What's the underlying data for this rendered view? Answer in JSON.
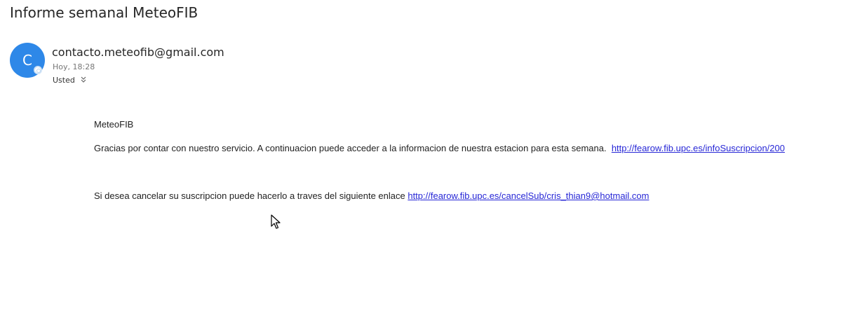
{
  "email": {
    "subject": "Informe semanal MeteoFIB",
    "avatar_letter": "C",
    "sender": "contacto.meteofib@gmail.com",
    "time": "Hoy, 18:28",
    "recipient": "Usted",
    "recipient_chevron": "»",
    "body": {
      "greeting": "MeteoFIB",
      "info_text": "Gracias por contar con nuestro servicio. A continuacion puede acceder a la informacion de nuestra estacion para esta semana.",
      "info_link": "http://fearow.fib.upc.es/infoSuscripcion/200",
      "cancel_text": "Si desea cancelar su suscripcion puede hacerlo a traves del siguiente enlace",
      "cancel_link": "http://fearow.fib.upc.es/cancelSub/cris_thian9@hotmail.com"
    }
  },
  "colors": {
    "avatar": "#2e88e8",
    "link": "#2626d6",
    "text": "#262626",
    "muted": "#777777"
  },
  "icons": {
    "cursor": "mouse-pointer-icon",
    "presence": "presence-status-icon",
    "expand": "chevron-double-down-icon"
  }
}
